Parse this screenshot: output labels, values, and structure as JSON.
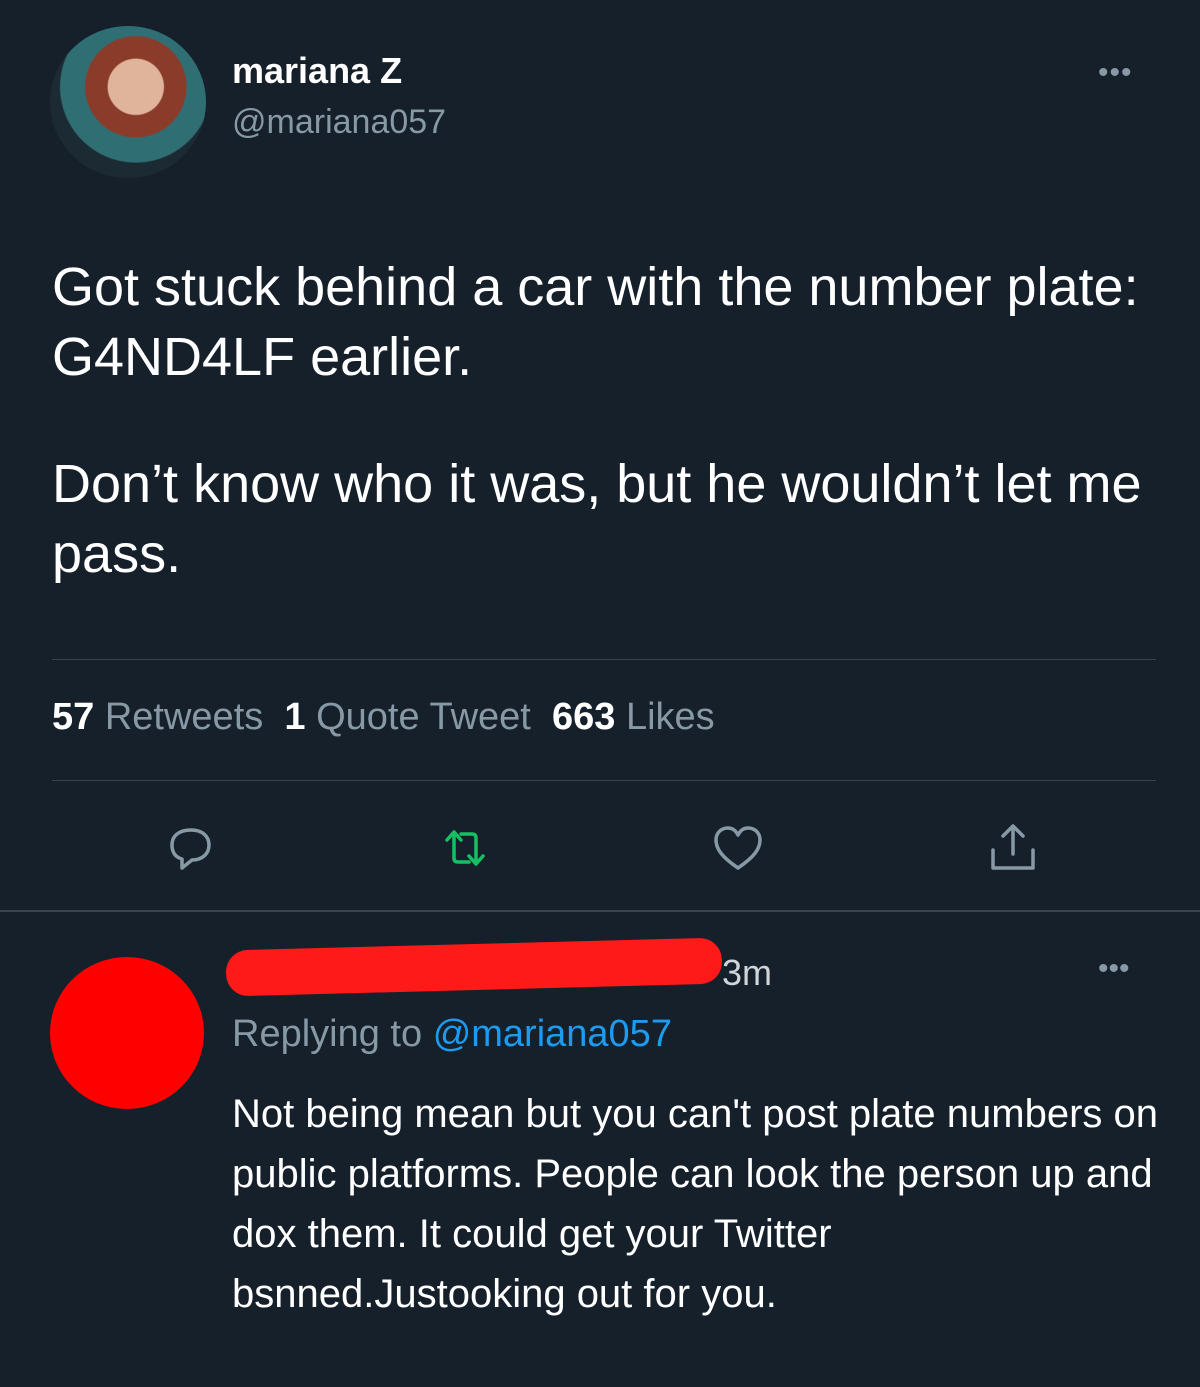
{
  "tweet": {
    "display_name": "mariana Z",
    "handle": "@mariana057",
    "more_icon": "more-horizontal-icon",
    "text_paragraph_1": "Got stuck behind a car with the number plate: G4ND4LF earlier.",
    "text_paragraph_2": "Don’t know who it was, but he wouldn’t let me pass.",
    "stats": {
      "retweets_count": "57",
      "retweets_label": "Retweets",
      "quotes_count": "1",
      "quotes_label": "Quote Tweet",
      "likes_count": "663",
      "likes_label": "Likes"
    },
    "actions": {
      "reply_icon": "reply-icon",
      "retweet_icon": "retweet-icon",
      "like_icon": "heart-icon",
      "share_icon": "share-icon"
    },
    "colors": {
      "background": "#15202b",
      "muted": "#8899a6",
      "retweet_active": "#17bf63",
      "link": "#1d9bf0"
    }
  },
  "reply": {
    "time": "3m",
    "replying_prefix": "Replying to",
    "replying_mention": "@mariana057",
    "text": "Not being mean but you can't post plate numbers on public platforms. People can look the person up and dox them. It could get your Twitter bsnned.Justooking out for you.",
    "redaction_color": "#ff0000"
  }
}
